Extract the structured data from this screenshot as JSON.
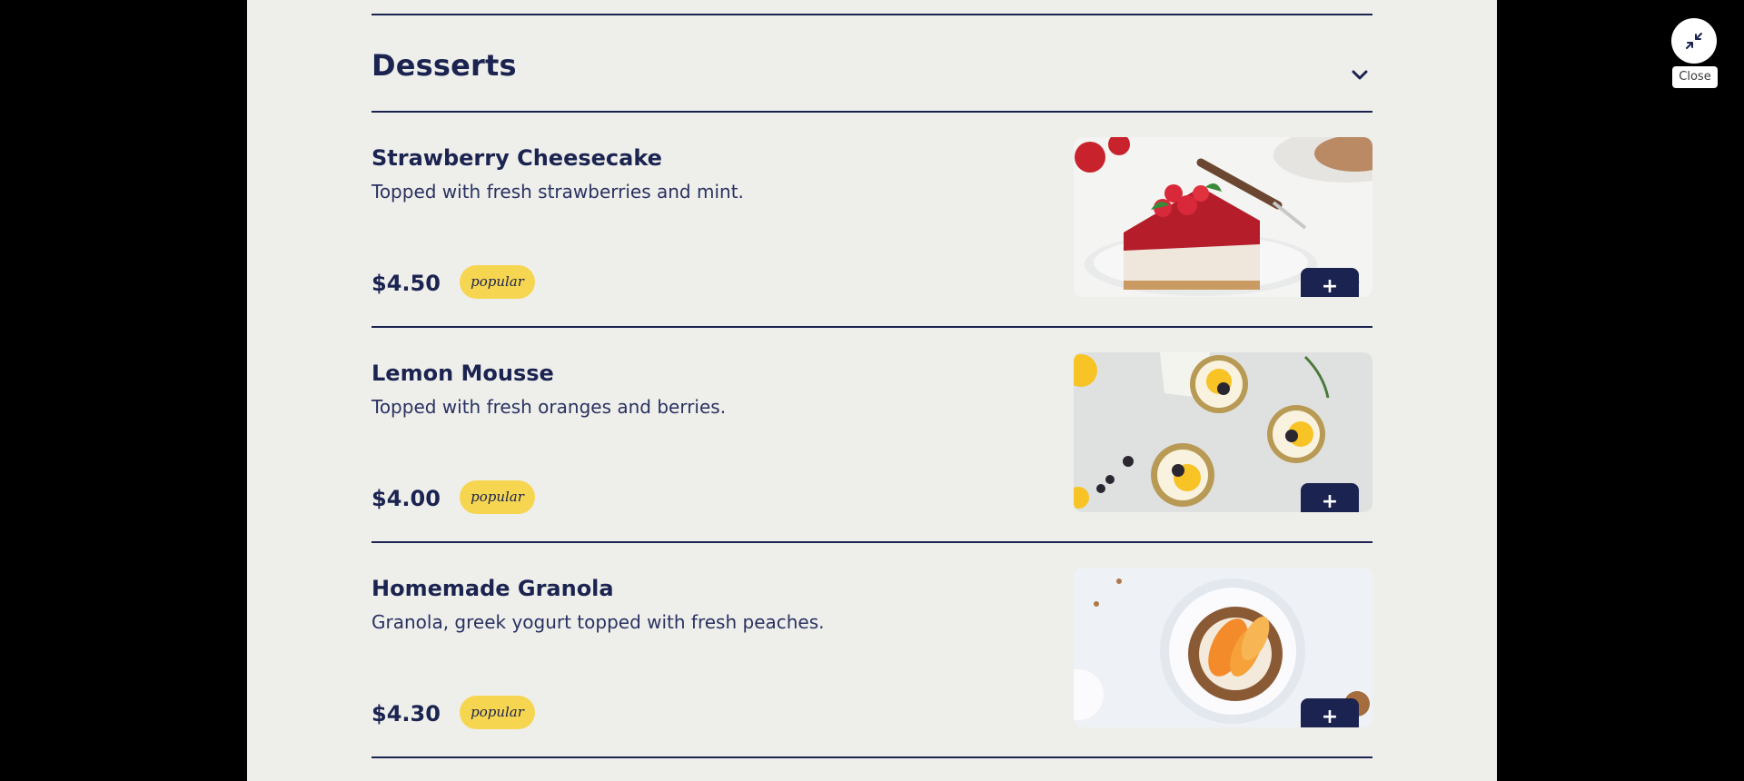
{
  "section": {
    "title": "Desserts",
    "chevron_icon": "chevron-down-icon"
  },
  "items": [
    {
      "name": "Strawberry Cheesecake",
      "description": "Topped with fresh strawberries and mint.",
      "price": "$4.50",
      "badge": "popular",
      "add_label": "+",
      "image": "strawberry-cheesecake-photo"
    },
    {
      "name": "Lemon Mousse",
      "description": "Topped with fresh oranges and berries.",
      "price": "$4.00",
      "badge": "popular",
      "add_label": "+",
      "image": "lemon-mousse-photo"
    },
    {
      "name": "Homemade Granola",
      "description": "Granola, greek yogurt topped with fresh peaches.",
      "price": "$4.30",
      "badge": "popular",
      "add_label": "+",
      "image": "homemade-granola-photo"
    }
  ],
  "close": {
    "label": "Close",
    "icon": "minimize-icon"
  },
  "colors": {
    "navy": "#1b2350",
    "badge_yellow": "#f6d651",
    "panel_bg": "#eeefeb",
    "backdrop": "#000000"
  }
}
